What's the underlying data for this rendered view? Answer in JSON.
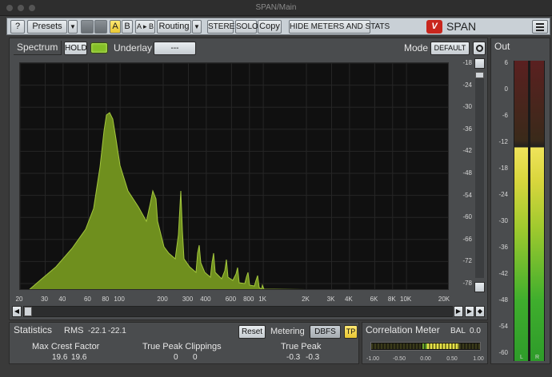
{
  "window": {
    "title": "SPAN/Main"
  },
  "toolbar": {
    "help": "?",
    "presets": "Presets",
    "presets_arrow": "▼",
    "a": "A",
    "b": "B",
    "ab": "A ▸ B",
    "routing": "Routing",
    "routing_arrow": "▼",
    "stereo": "STEREO",
    "solo": "SOLO",
    "copy": "Copy",
    "hide_meters": "HIDE METERS AND STATS",
    "logo_mark": "V",
    "logo_text": "SPAN",
    "active_button_color": "#f0d34a"
  },
  "spectrum": {
    "title": "Spectrum",
    "hold": "HOLD",
    "underlay_label": "Underlay",
    "underlay_value": "---",
    "mode_label": "Mode",
    "mode_value": "DEFAULT",
    "fill_color": "#6f8f1e",
    "db_labels": [
      "-18",
      "-24",
      "-30",
      "-36",
      "-42",
      "-48",
      "-54",
      "-60",
      "-66",
      "-72",
      "-78"
    ],
    "freq_labels": [
      "20",
      "30",
      "40",
      "60",
      "80",
      "100",
      "200",
      "300",
      "400",
      "600",
      "800",
      "1K",
      "2K",
      "3K",
      "4K",
      "6K",
      "8K",
      "10K",
      "20K"
    ]
  },
  "output": {
    "title": "Out",
    "scale": [
      "6",
      "0",
      "-6",
      "-12",
      "-18",
      "-24",
      "-30",
      "-36",
      "-42",
      "-48",
      "-54",
      "-60"
    ],
    "left": "L",
    "right": "R"
  },
  "statistics": {
    "title": "Statistics",
    "rms_label": "RMS",
    "rms_l": "-22.1",
    "rms_r": "-22.1",
    "reset": "Reset",
    "metering_label": "Metering",
    "metering_value": "DBFS",
    "tp": "TP",
    "crest_label": "Max Crest Factor",
    "crest_l": "19.6",
    "crest_r": "19.6",
    "clip_label": "True Peak Clippings",
    "clip_l": "0",
    "clip_r": "0",
    "peak_label": "True Peak",
    "peak_l": "-0.3",
    "peak_r": "-0.3"
  },
  "correlation": {
    "title": "Correlation Meter",
    "bal_label": "BAL",
    "bal_value": "0.0",
    "ticks": [
      "-1.00",
      "-0.50",
      "0.00",
      "0.50",
      "1.00"
    ]
  }
}
